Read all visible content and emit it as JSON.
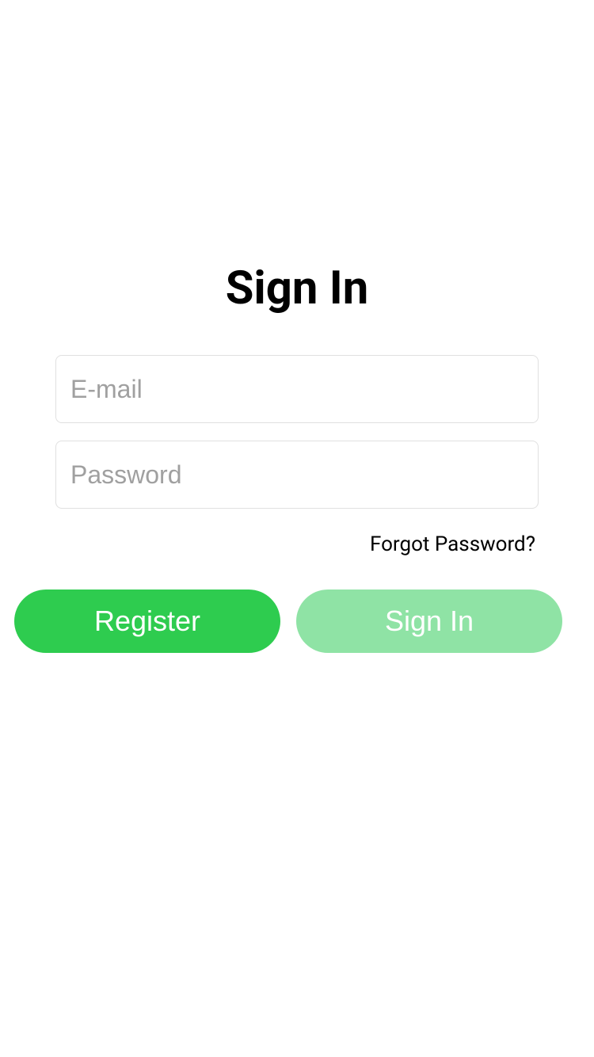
{
  "title": "Sign In",
  "inputs": {
    "email": {
      "placeholder": "E-mail",
      "value": ""
    },
    "password": {
      "placeholder": "Password",
      "value": ""
    }
  },
  "forgot_password_label": "Forgot Password?",
  "buttons": {
    "register_label": "Register",
    "signin_label": "Sign In"
  },
  "colors": {
    "primary_green": "#2ecc4f",
    "disabled_green": "#8fe3a5",
    "border": "#e0e0e0",
    "placeholder": "#a0a0a0"
  }
}
